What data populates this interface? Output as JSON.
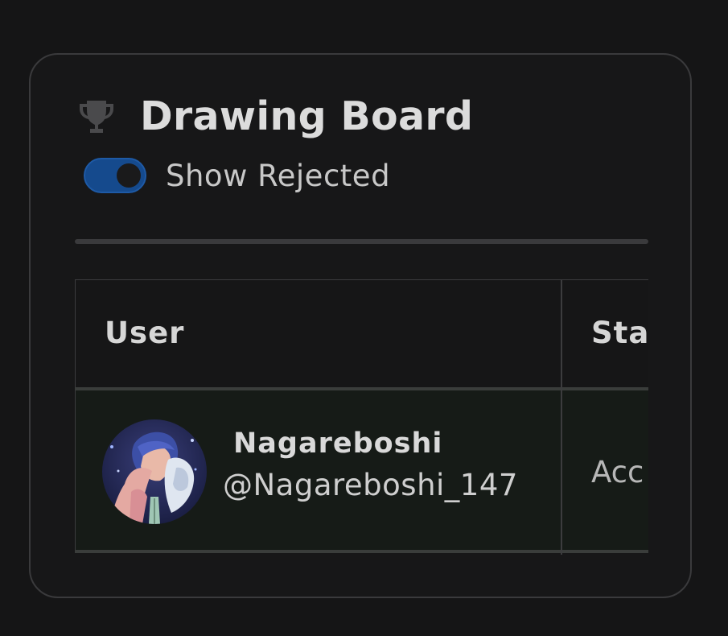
{
  "panel": {
    "title": "Drawing Board",
    "title_icon": "trophy-icon"
  },
  "filter": {
    "toggle_label": "Show Rejected",
    "toggle_on": true,
    "toggle_color": "#154a8d"
  },
  "table": {
    "columns": [
      "User",
      "Sta"
    ],
    "rows": [
      {
        "name": "Nagareboshi",
        "handle": "@Nagareboshi_147",
        "status": "Acc"
      }
    ]
  }
}
